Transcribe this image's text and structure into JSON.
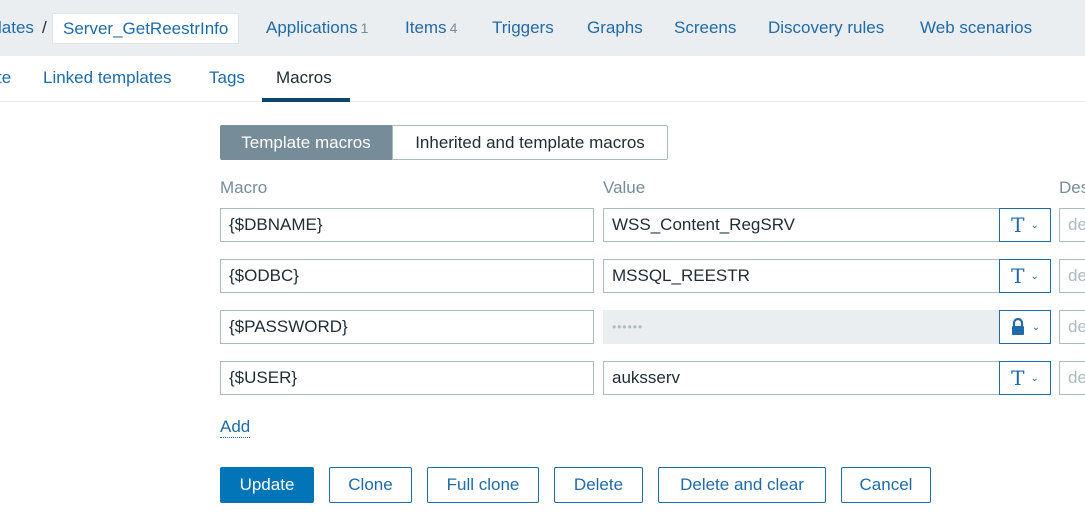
{
  "topnav": {
    "crumb_prev": "lates",
    "separator": "/",
    "crumb_current": "Server_GetReestrInfo",
    "applications_label": "Applications",
    "applications_count": "1",
    "items_label": "Items",
    "items_count": "4",
    "triggers": "Triggers",
    "graphs": "Graphs",
    "screens": "Screens",
    "discovery_rules": "Discovery rules",
    "web_scenarios": "Web scenarios"
  },
  "tabs": {
    "template": "te",
    "linked_templates": "Linked templates",
    "tags": "Tags",
    "macros": "Macros"
  },
  "segmented": {
    "template_macros": "Template macros",
    "inherited_macros": "Inherited and template macros"
  },
  "columns": {
    "macro": "Macro",
    "value": "Value",
    "description": "Des"
  },
  "macros": [
    {
      "macro": "{$DBNAME}",
      "value": "WSS_Content_RegSRV",
      "type_icon": "text-type-icon",
      "description_placeholder": "de"
    },
    {
      "macro": "{$ODBC}",
      "value": "MSSQL_REESTR",
      "type_icon": "text-type-icon",
      "description_placeholder": "de"
    },
    {
      "macro": "{$PASSWORD}",
      "value": "••••••",
      "type_icon": "lock-icon",
      "description_placeholder": "de"
    },
    {
      "macro": "{$USER}",
      "value": "auksserv",
      "type_icon": "text-type-icon",
      "description_placeholder": "de"
    }
  ],
  "type_glyph": "T",
  "add_label": "Add",
  "buttons": {
    "update": "Update",
    "clone": "Clone",
    "full_clone": "Full clone",
    "delete": "Delete",
    "delete_and_clear": "Delete and clear",
    "cancel": "Cancel"
  },
  "colors": {
    "link": "#1f6aa8",
    "primary_button": "#0275b8",
    "active_tab_underline": "#0a466a",
    "nav_background": "#ebeef0",
    "segment_active": "#768d99"
  }
}
